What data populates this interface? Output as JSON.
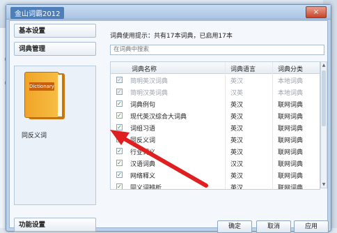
{
  "background": {
    "left_marks": [
      "《",
      "《"
    ]
  },
  "dialog": {
    "title": "金山词霸2012",
    "close_icon": "×"
  },
  "nav": {
    "basic_settings": "基本设置",
    "dict_management": "词典管理",
    "function_settings": "功能设置",
    "book_label": "Dictionary",
    "selected_dict": "同反义词"
  },
  "content": {
    "tip": "词典使用提示：共有17本词典，已启用17本",
    "search_placeholder": "在词典中搜索",
    "columns": [
      "词典名称",
      "词典语言",
      "词典分类"
    ],
    "rows": [
      {
        "name": "简明英汉词典",
        "lang": "英汉",
        "cat": "本地词典",
        "checked": true,
        "disabled": true
      },
      {
        "name": "简明汉英词典",
        "lang": "汉英",
        "cat": "本地词典",
        "checked": true,
        "disabled": true
      },
      {
        "name": "词典例句",
        "lang": "英汉",
        "cat": "联网词典",
        "checked": true,
        "disabled": false
      },
      {
        "name": "现代英汉综合大词典",
        "lang": "英汉",
        "cat": "联网词典",
        "checked": true,
        "disabled": false
      },
      {
        "name": "词组习语",
        "lang": "英汉",
        "cat": "联网词典",
        "checked": true,
        "disabled": false
      },
      {
        "name": "同反义词",
        "lang": "英汉",
        "cat": "联网词典",
        "checked": false,
        "disabled": false
      },
      {
        "name": "行业词义",
        "lang": "英汉",
        "cat": "联网词典",
        "checked": true,
        "disabled": false
      },
      {
        "name": "汉语词典",
        "lang": "汉汉",
        "cat": "联网词典",
        "checked": true,
        "disabled": false
      },
      {
        "name": "网络释义",
        "lang": "英汉",
        "cat": "联网词典",
        "checked": true,
        "disabled": false
      },
      {
        "name": "同义词辨析",
        "lang": "英汉",
        "cat": "联网词典",
        "checked": true,
        "disabled": false
      }
    ]
  },
  "footer": {
    "ok": "确定",
    "cancel": "取消",
    "apply": "应用"
  },
  "colors": {
    "accent": "#4f7fb8",
    "arrow": "#e02020",
    "check": "#2a8a2a"
  }
}
